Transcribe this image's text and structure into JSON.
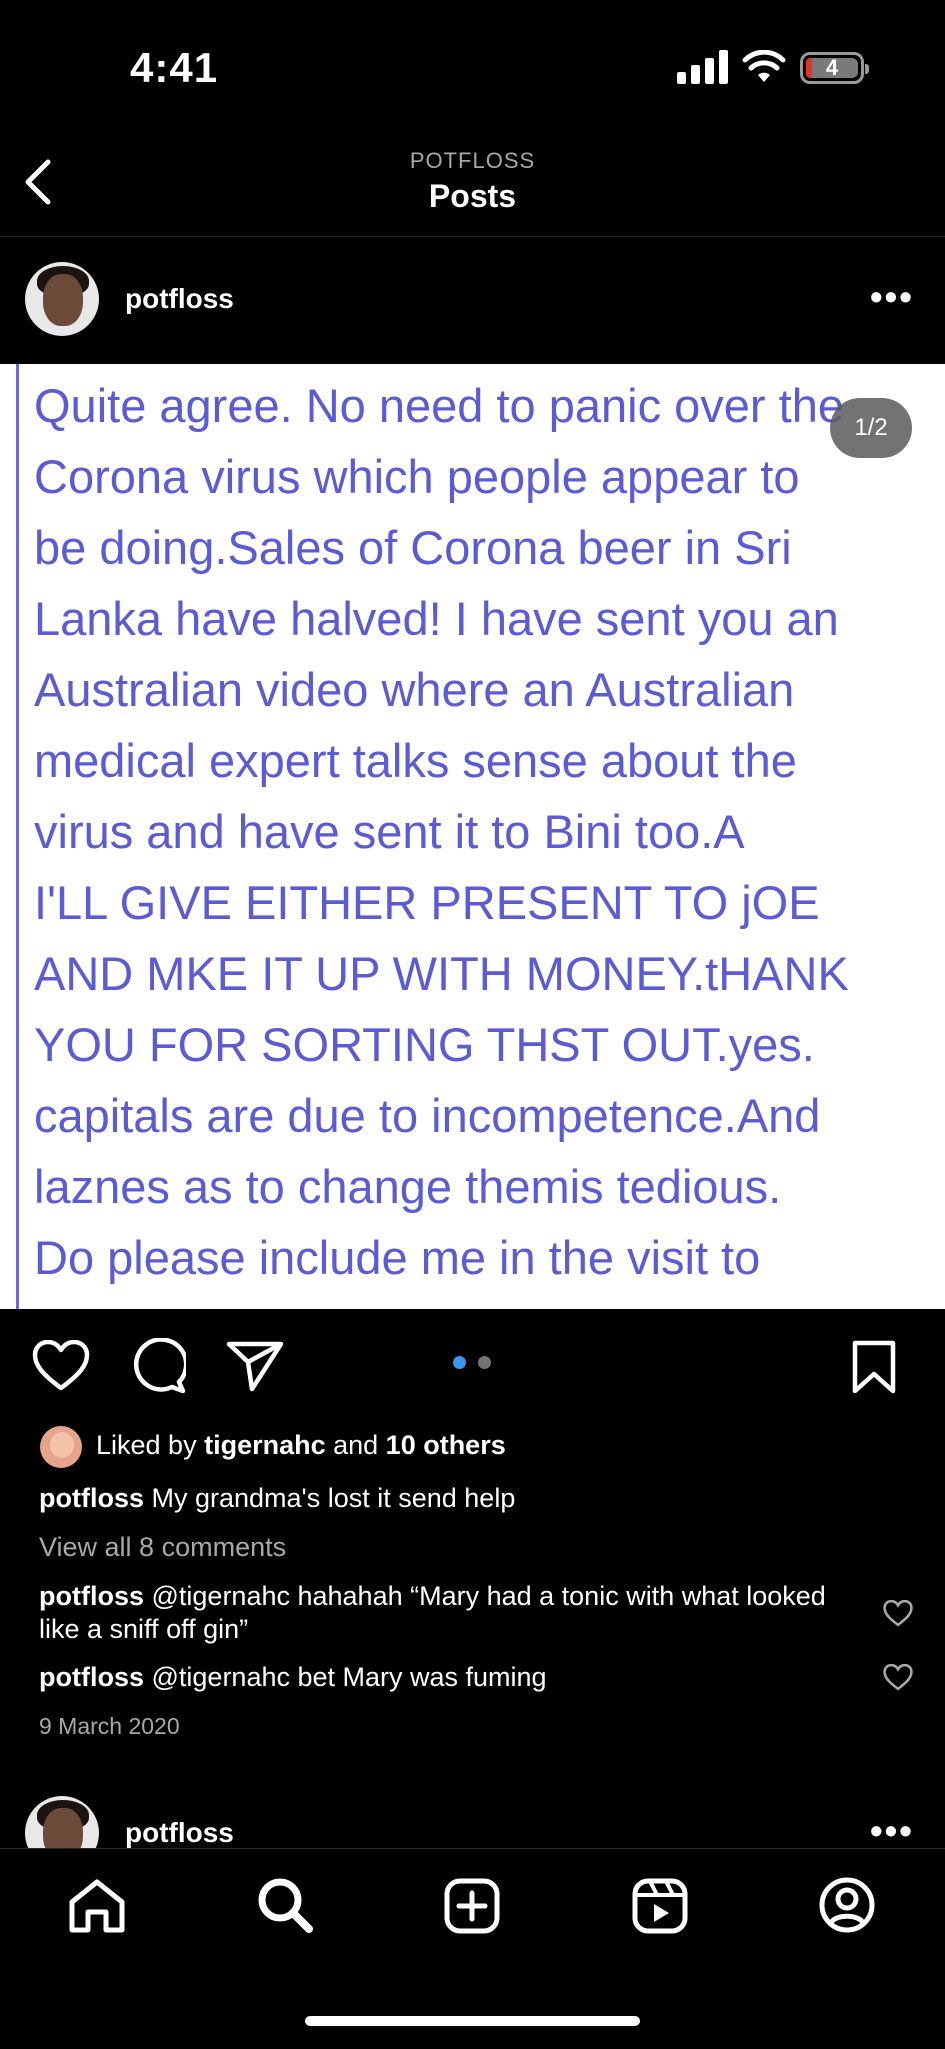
{
  "status_bar": {
    "time": "4:41",
    "battery": "4"
  },
  "header": {
    "subtitle": "POTFLOSS",
    "title": "Posts"
  },
  "post": {
    "username": "potfloss",
    "image_counter": "1/2",
    "image_text_lines": [
      "Quite agree. No need to panic over the",
      "Corona virus which people appear to",
      "be doing.Sales of Corona beer in Sri",
      "Lanka have halved! I have sent you an",
      "Australian video where an Australian",
      "medical expert talks sense about the",
      "virus and have sent it to Bini too.A",
      "I'LL GIVE EITHER PRESENT TO jOE",
      "AND MKE IT UP WITH MONEY.tHANK",
      "YOU FOR SORTING THST OUT.yes.",
      "capitals are due to incompetence.And",
      "laznes as to change themis tedious.",
      "Do please include me in the visit to"
    ],
    "likes": {
      "prefix": "Liked by ",
      "user": "tigernahc",
      "middle": " and ",
      "others": "10 others"
    },
    "caption": {
      "user": "potfloss",
      "text": " My grandma's lost it send help"
    },
    "view_comments": "View all 8 comments",
    "comments": [
      {
        "user": "potfloss",
        "text": " @tigernahc hahahah “Mary had a tonic with what looked like a sniff off gin”"
      },
      {
        "user": "potfloss",
        "text": " @tigernahc bet Mary was fuming"
      }
    ],
    "date": "9 March 2020"
  },
  "next_post": {
    "username": "potfloss"
  },
  "colors": {
    "image_text": "#5b5bd6",
    "carousel_active": "#3897f0",
    "carousel_inactive": "#737373"
  },
  "icons": [
    "back-chevron-icon",
    "heart-icon",
    "comment-icon",
    "share-icon",
    "bookmark-icon",
    "home-icon",
    "search-icon",
    "create-icon",
    "reels-icon",
    "profile-icon"
  ]
}
